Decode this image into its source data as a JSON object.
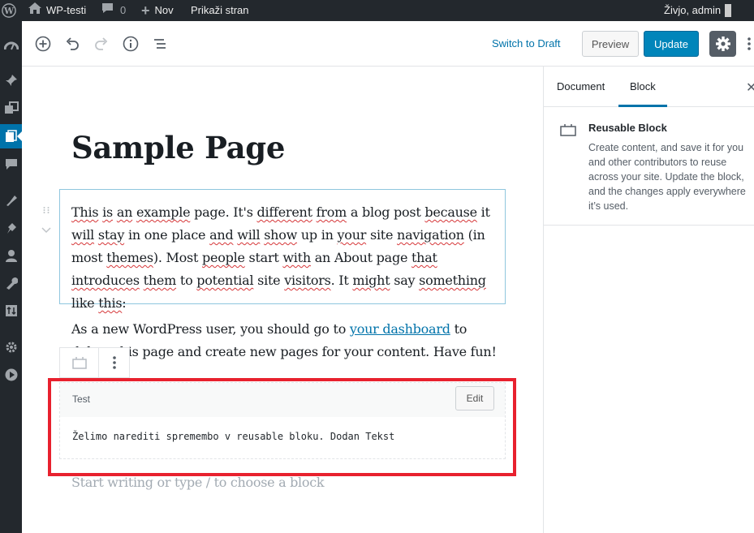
{
  "admin_bar": {
    "site_name": "WP-testi",
    "comments_count": "0",
    "new_label": "Nov",
    "view_label": "Prikaži stran",
    "account_label": "Živjo, admin"
  },
  "toolbar": {
    "switch_to_draft": "Switch to Draft",
    "preview": "Preview",
    "update": "Update"
  },
  "sidebar": {
    "tabs": [
      {
        "label": "Document",
        "active": false
      },
      {
        "label": "Block",
        "active": true
      }
    ],
    "close_icon": "close-icon",
    "block_card": {
      "title": "Reusable Block",
      "description": "Create content, and save it for you and other contributors to reuse across your site. Update the block, and the changes apply everywhere it’s used."
    }
  },
  "post": {
    "title": "Sample Page",
    "para1_words": [
      "This",
      " ",
      "is",
      " ",
      "an",
      " ",
      "example",
      " page. It's ",
      "different",
      " ",
      "from",
      " a blog post ",
      "because",
      " it ",
      "will",
      " ",
      "stay",
      " in one place ",
      "and",
      " ",
      "will",
      " ",
      "show",
      " up in ",
      "your",
      " site ",
      "navigation",
      " (in most ",
      "themes",
      "). Most ",
      "people",
      " start ",
      "with",
      " an About page ",
      "that",
      " ",
      "introduces",
      " ",
      "them",
      " to ",
      "potential",
      " site ",
      "visitors",
      ". It ",
      "might",
      " say ",
      "something",
      " like ",
      "this",
      ":"
    ],
    "para2_before": "As a new WordPress user, you should go to ",
    "para2_link": "your dashboard",
    "para2_after": " to delete this page and create new pages for your content. Have fun!",
    "appender_placeholder": "Start writing or type / to choose a block"
  },
  "reusable_block": {
    "title": "Test",
    "edit_label": "Edit",
    "content": "Želimo narediti spremembo v reusable bloku. Dodan Tekst"
  },
  "colors": {
    "admin_bar_bg": "#23282d",
    "accent": "#0073aa",
    "update_button": "#0085ba",
    "highlight_border": "#e8212e"
  }
}
